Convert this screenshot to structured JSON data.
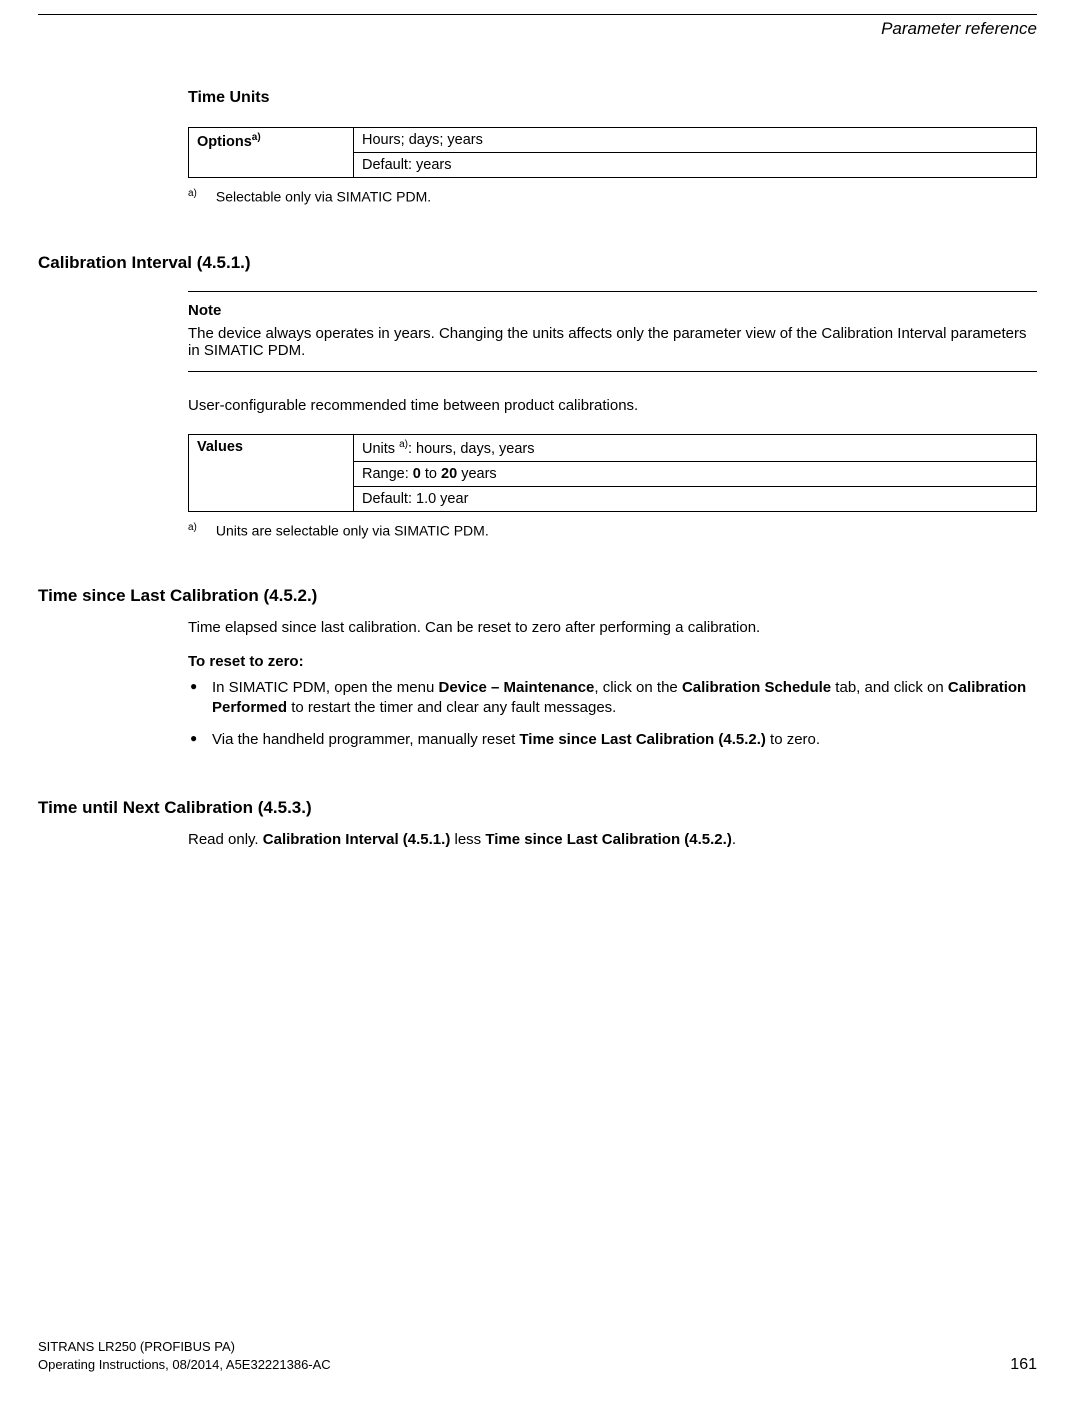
{
  "header": {
    "chapter": "Parameter reference"
  },
  "section_time_units": {
    "title": "Time Units",
    "table": {
      "label": "Options",
      "label_sup": "a)",
      "row1": "Hours; days; years",
      "row2": "Default: years"
    },
    "footnote_sup": "a)",
    "footnote": "Selectable only via SIMATIC PDM."
  },
  "section_cal_interval": {
    "title": "Calibration Interval (4.5.1.)",
    "note_title": "Note",
    "note_text": "The device always operates in years. Changing the units affects only the parameter view of the Calibration Interval parameters in SIMATIC PDM.",
    "desc": "User-configurable recommended time between product calibrations.",
    "table": {
      "label": "Values",
      "row1_pre": "Units ",
      "row1_sup": "a)",
      "row1_post": ": hours, days, years",
      "row2_pre": "Range: ",
      "row2_b1": "0",
      "row2_mid": " to ",
      "row2_b2": "20",
      "row2_post": " years",
      "row3": "Default: 1.0 year"
    },
    "footnote_sup": "a)",
    "footnote": "Units are selectable only via SIMATIC PDM."
  },
  "section_time_since": {
    "title": "Time since Last Calibration (4.5.2.)",
    "desc": "Time elapsed since last calibration. Can be reset to zero after performing a calibration.",
    "reset_title": "To reset to zero:",
    "bullet1_p1": "In SIMATIC PDM, open the menu ",
    "bullet1_b1": "Device – Maintenance",
    "bullet1_p2": ", click on the ",
    "bullet1_b2": "Calibration Schedule",
    "bullet1_p3": " tab, and click on ",
    "bullet1_b3": "Calibration Performed",
    "bullet1_p4": " to restart the timer and clear any fault messages.",
    "bullet2_p1": "Via the handheld programmer, manually reset ",
    "bullet2_b1": "Time since Last Calibration (4.5.2.)",
    "bullet2_p2": " to zero."
  },
  "section_time_until": {
    "title": "Time until Next Calibration (4.5.3.)",
    "p1": "Read only. ",
    "b1": "Calibration Interval (4.5.1.)",
    "p2": " less ",
    "b2": "Time since Last Calibration (4.5.2.)",
    "p3": "."
  },
  "footer": {
    "line1": "SITRANS LR250 (PROFIBUS PA)",
    "line2": "Operating Instructions, 08/2014, A5E32221386-AC",
    "page": "161"
  }
}
